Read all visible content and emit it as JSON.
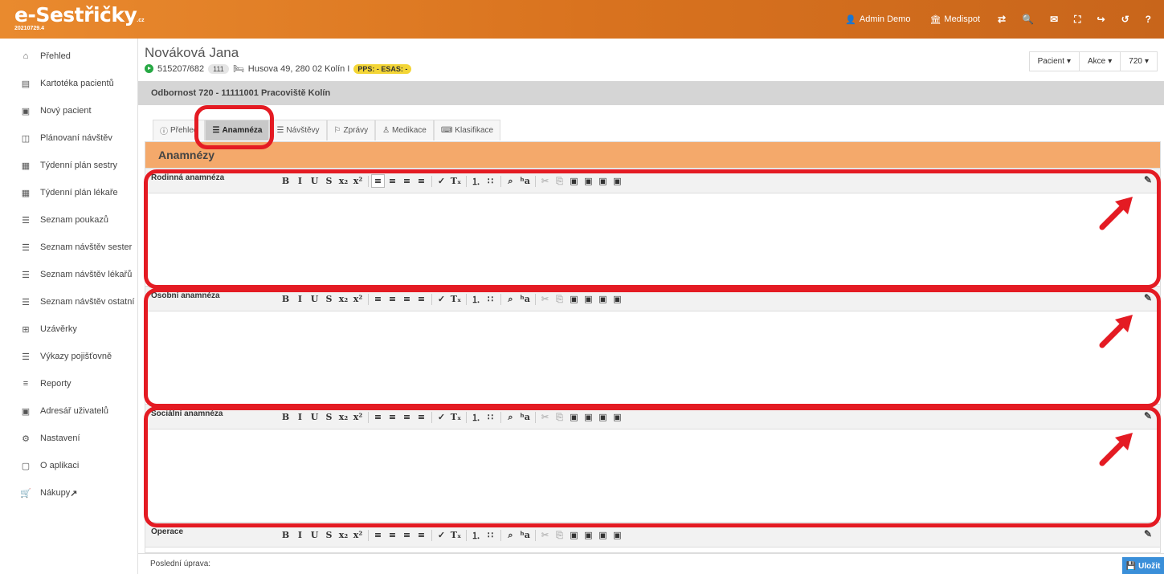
{
  "app": {
    "logo": "e-Sestřičky",
    "logo_tld": ".cz",
    "version": "20210729.4"
  },
  "header": {
    "user": "Admin Demo",
    "org": "Medispot",
    "icons": [
      "swap-icon",
      "search-icon",
      "mail-icon",
      "fullscreen-icon",
      "logout-icon",
      "history-icon",
      "help-icon"
    ]
  },
  "sidebar": {
    "items": [
      {
        "label": "Přehled",
        "icon": "home-icon",
        "glyph": "⌂"
      },
      {
        "label": "Kartotéka pacientů",
        "icon": "id-card-icon",
        "glyph": "▤"
      },
      {
        "label": "Nový pacient",
        "icon": "user-card-icon",
        "glyph": "▣"
      },
      {
        "label": "Plánovaní návštěv",
        "icon": "map-icon",
        "glyph": "◫"
      },
      {
        "label": "Týdenní plán sestry",
        "icon": "calendar-icon",
        "glyph": "▦"
      },
      {
        "label": "Týdenní plán lékaře",
        "icon": "calendar-icon",
        "glyph": "▦"
      },
      {
        "label": "Seznam poukazů",
        "icon": "list-icon",
        "glyph": "☰"
      },
      {
        "label": "Seznam návštěv sester",
        "icon": "list-icon",
        "glyph": "☰"
      },
      {
        "label": "Seznam návštěv lékařů",
        "icon": "list-icon",
        "glyph": "☰"
      },
      {
        "label": "Seznam návštěv ostatní",
        "icon": "list-icon",
        "glyph": "☰"
      },
      {
        "label": "Uzávěrky",
        "icon": "table-icon",
        "glyph": "⊞"
      },
      {
        "label": "Výkazy pojišťovně",
        "icon": "list-icon",
        "glyph": "☰"
      },
      {
        "label": "Reporty",
        "icon": "report-icon",
        "glyph": "≡"
      },
      {
        "label": "Adresář uživatelů",
        "icon": "address-book-icon",
        "glyph": "▣"
      },
      {
        "label": "Nastavení",
        "icon": "settings-icon",
        "glyph": "⚙"
      },
      {
        "label": "O aplikaci",
        "icon": "info-icon",
        "glyph": "▢"
      },
      {
        "label": "Nákupy",
        "icon": "cart-icon",
        "glyph": "🛒"
      }
    ]
  },
  "patient": {
    "name": "Nováková Jana",
    "id": "515207/682",
    "insurance": "111",
    "address": "Husova 49, 280 02 Kolín I",
    "pps": "PPS: - ESAS: -"
  },
  "actions": {
    "patient": "Pacient",
    "akce": "Akce",
    "code": "720"
  },
  "department": "Odbornost 720 - 11111001 Pracoviště Kolín",
  "tabs": [
    {
      "label": "Přehled"
    },
    {
      "label": "Anamnéza"
    },
    {
      "label": "Návštěvy"
    },
    {
      "label": "Zprávy"
    },
    {
      "label": "Medikace"
    },
    {
      "label": "Klasifikace"
    }
  ],
  "section": {
    "title": "Anamnézy"
  },
  "editors": [
    {
      "label": "Rodinná anamnéza"
    },
    {
      "label": "Osobní anamnéza"
    },
    {
      "label": "Sociální anamnéza"
    },
    {
      "label": "Operace"
    }
  ],
  "footer": {
    "last_edit": "Poslední úprava:",
    "save": "Uložit"
  },
  "annotation_color": "#e41b23"
}
